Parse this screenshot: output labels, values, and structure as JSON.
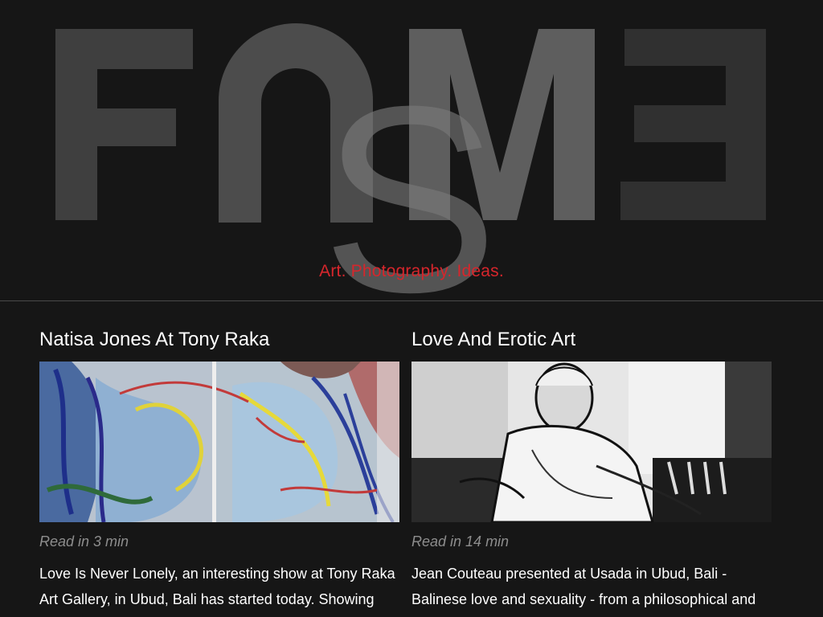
{
  "site": {
    "logo_letters": [
      "F",
      "U",
      "M",
      "E",
      "S"
    ],
    "tagline": "Art. Photography. Ideas.",
    "colors": {
      "background": "#161616",
      "tagline": "#d6262c",
      "read_time": "#8d8d8d",
      "divider": "#4a4a4a"
    }
  },
  "articles": [
    {
      "title": "Natisa Jones At Tony Raka",
      "image_desc": "colorful-abstract-painting",
      "read_time": "Read in 3 min",
      "excerpt": "Love Is Never Lonely, an interesting show at Tony Raka Art Gallery, in Ubud, Bali has started today. Showing"
    },
    {
      "title": "Love And Erotic Art",
      "image_desc": "black-and-white-portrait-of-seated-man",
      "read_time": "Read in 14 min",
      "excerpt": "Jean Couteau presented at Usada in Ubud, Bali - Balinese love and sexuality - from a philosophical and"
    }
  ]
}
